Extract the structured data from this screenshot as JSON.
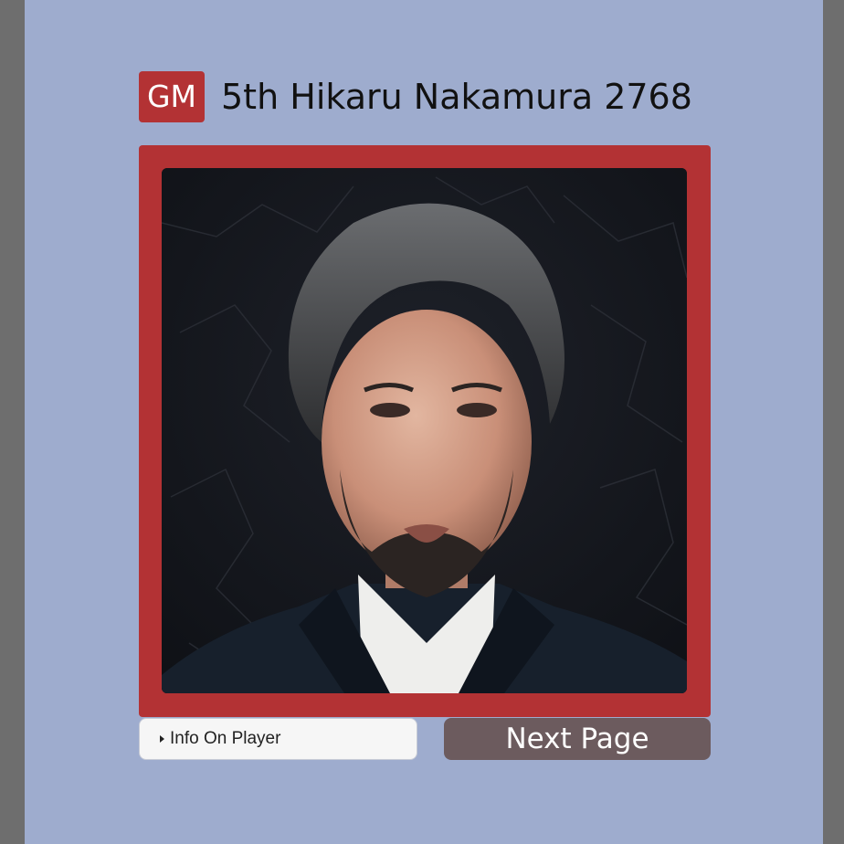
{
  "player": {
    "title_badge": "GM",
    "heading": "5th Hikaru Nakamura 2768"
  },
  "photo": {
    "subject": "portrait of Hikaru Nakamura"
  },
  "controls": {
    "info_label": "Info On Player",
    "next_label": "Next Page"
  },
  "colors": {
    "page_background": "#9eacce",
    "outer_background": "#6e6e6e",
    "accent_red": "#b33234",
    "next_button": "#6c5b5e",
    "info_box": "#f6f6f6"
  }
}
